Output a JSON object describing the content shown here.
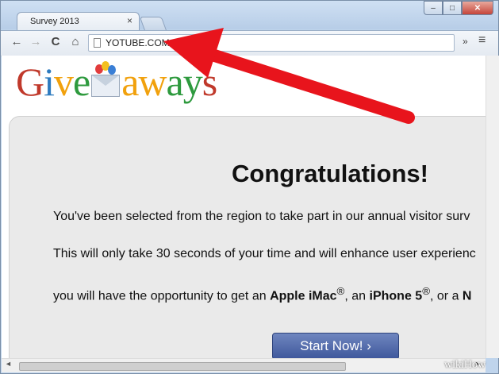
{
  "browser": {
    "tab_title": "Survey 2013",
    "tab_close": "×",
    "url": "YOTUBE.COM",
    "nav": {
      "back": "←",
      "forward": "→",
      "reload": "C",
      "home": "⌂"
    },
    "extensions": "»",
    "menu": "≡",
    "window": {
      "minimize": "–",
      "maximize": "□",
      "close": "✕"
    }
  },
  "logo": {
    "left": "Give",
    "right": "aways",
    "colors": {
      "G": "#c0392b",
      "i": "#2e7bbf",
      "v": "#f1a10d",
      "e": "#2e9a3e",
      "aways": "#f1a10d"
    }
  },
  "main": {
    "heading": "Congratulations!",
    "line1": "You've been selected from the region to take part in our annual visitor surv",
    "line2": "This will only take 30 seconds of your time and will enhance user experienc",
    "line3": {
      "prefix": "you will have the opportunity to get an ",
      "prize1": "Apple iMac",
      "reg": "®",
      "mid": ", an ",
      "prize2": "iPhone 5",
      "suffix": ", or a ",
      "tail": "N"
    },
    "button": "Start Now! ›"
  },
  "scrollbar": {
    "left": "◄",
    "right": "►"
  },
  "watermark": "wikiHow",
  "annotation_color": "#e8141c"
}
